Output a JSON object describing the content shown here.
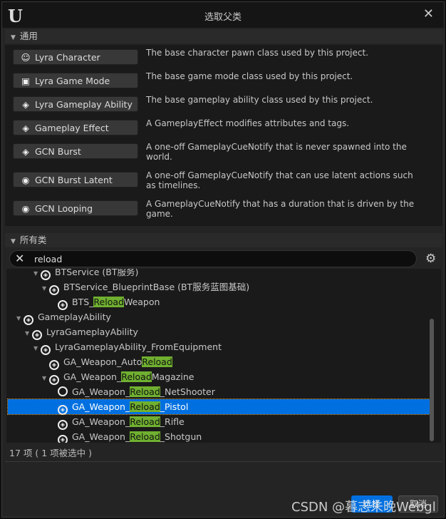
{
  "window": {
    "title": "选取父类",
    "close_icon": "close-icon",
    "logo": "unreal-logo"
  },
  "common": {
    "header": "通用",
    "items": [
      {
        "label": "Lyra Character",
        "icon": "person-icon",
        "glyph": "☺",
        "desc": "The base character pawn class used by this project."
      },
      {
        "label": "Lyra Game Mode",
        "icon": "game-mode-icon",
        "glyph": "▣",
        "desc": "The base game mode class used by this project."
      },
      {
        "label": "Lyra Gameplay Ability",
        "icon": "blueprint-icon",
        "glyph": "◈",
        "desc": "The base gameplay ability class used by this project."
      },
      {
        "label": "Gameplay Effect",
        "icon": "blueprint-icon",
        "glyph": "◈",
        "desc": "A GameplayEffect modifies attributes and tags."
      },
      {
        "label": "GCN Burst",
        "icon": "blueprint-icon",
        "glyph": "◈",
        "desc": "A one-off GameplayCueNotify that is never spawned into the world."
      },
      {
        "label": "GCN Burst Latent",
        "icon": "cue-icon",
        "glyph": "◉",
        "desc": "A one-off GameplayCueNotify that can use latent actions such as timelines."
      },
      {
        "label": "GCN Looping",
        "icon": "cue-icon",
        "glyph": "◉",
        "desc": "A GameplayCueNotify that has a duration that is driven by the game."
      }
    ]
  },
  "all": {
    "header": "所有类",
    "search_value": "reload",
    "gear_icon": "settings-icon",
    "tree": [
      {
        "pre": "BTService (BT服务)",
        "hl": "",
        "post": "",
        "indent": 3,
        "arrow": true
      },
      {
        "pre": "BTService_BlueprintBase (BT服务蓝图基础)",
        "hl": "",
        "post": "",
        "indent": 4,
        "arrow": true
      },
      {
        "pre": "BTS_",
        "hl": "Reload",
        "post": "Weapon",
        "indent": 5,
        "arrow": false
      },
      {
        "pre": "GameplayAbility",
        "hl": "",
        "post": "",
        "indent": 1,
        "arrow": true
      },
      {
        "pre": "LyraGameplayAbility",
        "hl": "",
        "post": "",
        "indent": 2,
        "arrow": true
      },
      {
        "pre": "LyraGameplayAbility_FromEquipment",
        "hl": "",
        "post": "",
        "indent": 3,
        "arrow": true
      },
      {
        "pre": "GA_Weapon_Auto",
        "hl": "Reload",
        "post": "",
        "indent": 4,
        "arrow": false
      },
      {
        "pre": "GA_Weapon_",
        "hl": "Reload",
        "post": "Magazine",
        "indent": 4,
        "arrow": true
      },
      {
        "pre": "GA_Weapon_",
        "hl": "Reload",
        "post": "_NetShooter",
        "indent": 5,
        "arrow": false,
        "ring": true
      },
      {
        "pre": "GA_Weapon_",
        "hl": "Reload",
        "post": "_Pistol",
        "indent": 5,
        "arrow": false,
        "selected": true
      },
      {
        "pre": "GA_Weapon_",
        "hl": "Reload",
        "post": "_Rifle",
        "indent": 5,
        "arrow": false
      },
      {
        "pre": "GA_Weapon_",
        "hl": "Reload",
        "post": "_Shotgun",
        "indent": 5,
        "arrow": false
      }
    ],
    "status": "17 项 ( 1 项被选中 )"
  },
  "footer": {
    "select": "选择",
    "cancel": "取消"
  },
  "watermark": "CSDN @暮志未晚Webgl",
  "colors": {
    "selection": "#0070e0",
    "highlight": "#70b030"
  }
}
